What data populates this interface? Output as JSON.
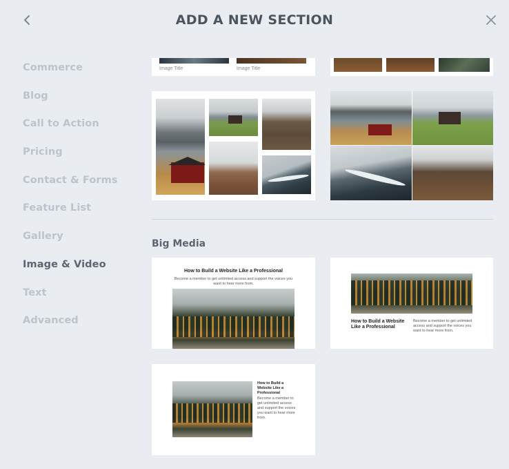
{
  "header": {
    "title": "ADD A NEW SECTION"
  },
  "sidebar": {
    "items": [
      {
        "label": "Commerce"
      },
      {
        "label": "Blog"
      },
      {
        "label": "Call to Action"
      },
      {
        "label": "Pricing"
      },
      {
        "label": "Contact & Forms"
      },
      {
        "label": "Feature List"
      },
      {
        "label": "Gallery"
      },
      {
        "label": "Image & Video"
      },
      {
        "label": "Text"
      },
      {
        "label": "Advanced"
      }
    ],
    "active": "Image & Video"
  },
  "gallery_cards": {
    "top_left_caption_1": "Image Title",
    "top_left_caption_2": "Image Title"
  },
  "big_media": {
    "heading": "Big Media",
    "card1": {
      "title": "How to Build a Website Like a Professional",
      "text": "Become a member to get unlimited access and support the voices you want to hear more from."
    },
    "card2": {
      "title": "How to Build a Website Like a Professional",
      "text": "Become a member to get unlimited access and support the voices you want to hear more from."
    },
    "card3": {
      "title": "How to Build a Website Like a Professional",
      "text": "Become a member to get unlimited access and support the voices you want to hear more from."
    }
  },
  "colors": {
    "background": "#e9ecf1",
    "active_text": "#5d6670",
    "inactive_text": "#bcc3cc"
  }
}
